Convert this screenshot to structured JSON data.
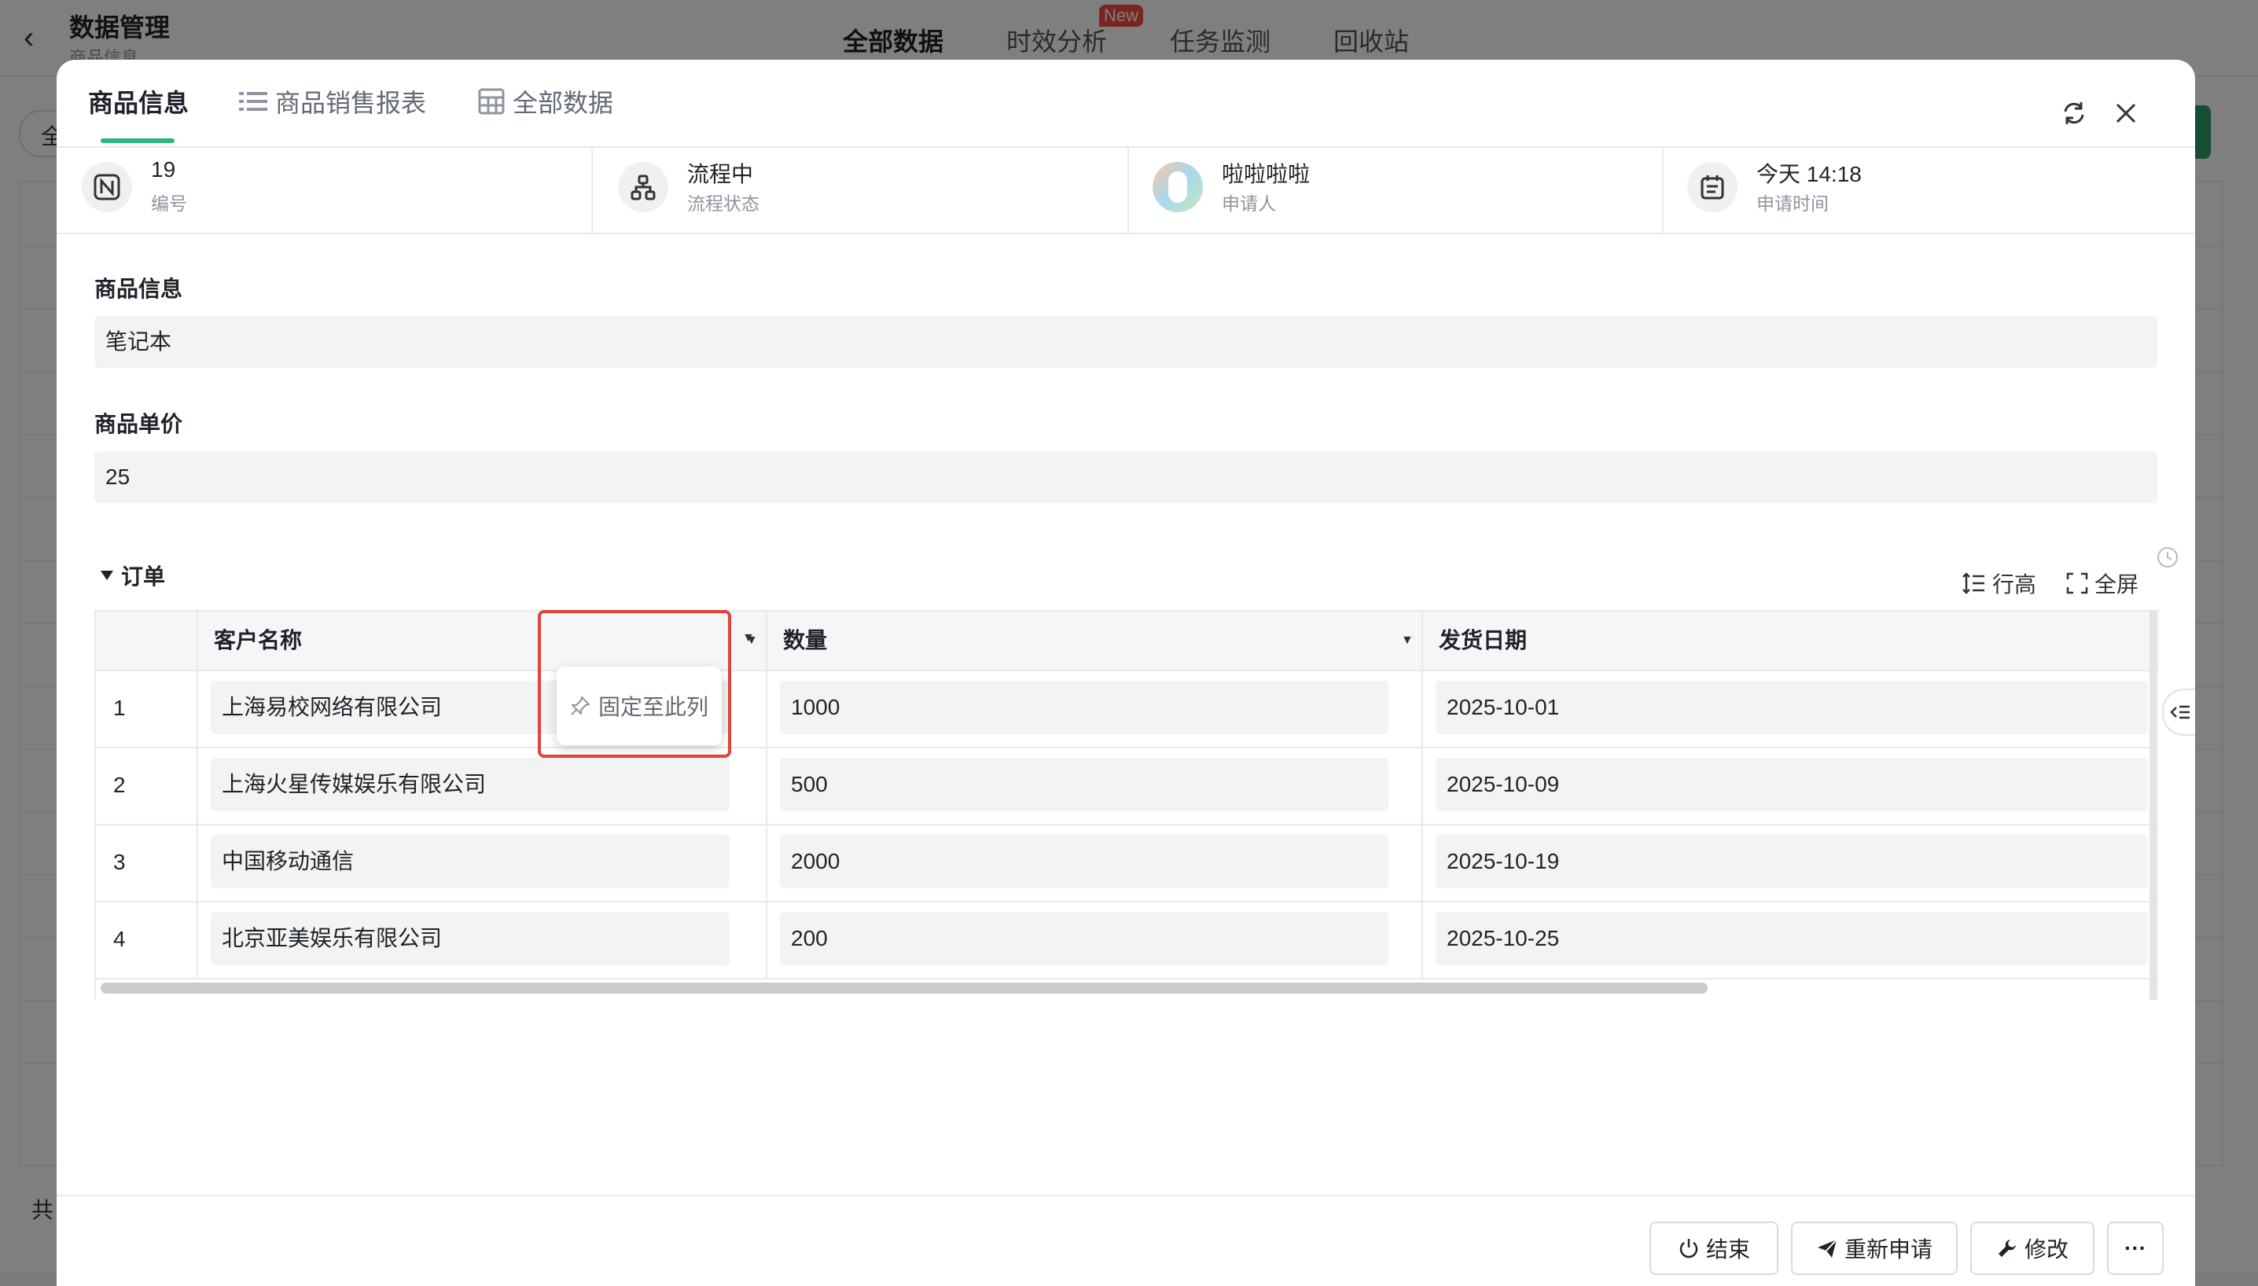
{
  "background": {
    "title": "数据管理",
    "subtitle": "商品信息",
    "tabs": [
      "全部数据",
      "时效分析",
      "任务监测",
      "回收站"
    ],
    "new_badge": "New",
    "search_text": "全",
    "footer_text": "共"
  },
  "modal": {
    "tabs": [
      {
        "label": "商品信息",
        "icon": "none"
      },
      {
        "label": "商品销售报表",
        "icon": "list-icon"
      },
      {
        "label": "全部数据",
        "icon": "table-icon"
      }
    ],
    "info": [
      {
        "value": "19",
        "label": "编号",
        "icon": "number-icon"
      },
      {
        "value": "流程中",
        "label": "流程状态",
        "icon": "flow-icon"
      },
      {
        "value": "啦啦啦啦",
        "label": "申请人",
        "icon": "avatar"
      },
      {
        "value": "今天 14:18",
        "label": "申请时间",
        "icon": "calendar-icon"
      }
    ],
    "fields": [
      {
        "label": "商品信息",
        "value": "笔记本"
      },
      {
        "label": "商品单价",
        "value": "25"
      }
    ],
    "subtable": {
      "title": "订单",
      "row_height_label": "行高",
      "fullscreen_label": "全屏",
      "columns": [
        "客户名称",
        "",
        "数量",
        "发货日期"
      ],
      "rows": [
        {
          "index": "1",
          "customer": "上海易校网络有限公司",
          "quantity": "1000",
          "date": "2025-10-01"
        },
        {
          "index": "2",
          "customer": "上海火星传媒娱乐有限公司",
          "quantity": "500",
          "date": "2025-10-09"
        },
        {
          "index": "3",
          "customer": "中国移动通信",
          "quantity": "2000",
          "date": "2025-10-19"
        },
        {
          "index": "4",
          "customer": "北京亚美娱乐有限公司",
          "quantity": "200",
          "date": "2025-10-25"
        }
      ],
      "pin_menu_label": "固定至此列"
    },
    "footer": {
      "end_label": "结束",
      "reapply_label": "重新申请",
      "edit_label": "修改",
      "more_label": "···"
    },
    "accent_color": "#2fb47c",
    "highlight_color": "#e0453a"
  }
}
